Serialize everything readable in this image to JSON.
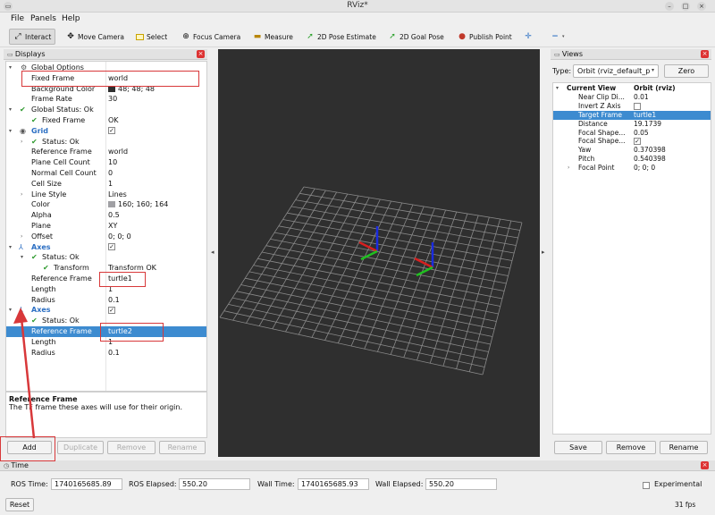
{
  "window": {
    "title": "RViz*"
  },
  "menu": [
    "File",
    "Panels",
    "Help"
  ],
  "toolbar": {
    "interact": "Interact",
    "move_camera": "Move Camera",
    "select": "Select",
    "focus_camera": "Focus Camera",
    "measure": "Measure",
    "pose_estimate": "2D Pose Estimate",
    "goal_pose": "2D Goal Pose",
    "publish_point": "Publish Point"
  },
  "displays": {
    "title": "Displays",
    "rows": [
      {
        "name": "Global Options",
        "value": ""
      },
      {
        "name": "Fixed Frame",
        "value": "world"
      },
      {
        "name": "Background Color",
        "value": "48; 48; 48"
      },
      {
        "name": "Frame Rate",
        "value": "30"
      },
      {
        "name": "Global Status: Ok",
        "value": ""
      },
      {
        "name": "Fixed Frame",
        "value": "OK"
      },
      {
        "name": "Grid",
        "value": ""
      },
      {
        "name": "Status: Ok",
        "value": ""
      },
      {
        "name": "Reference Frame",
        "value": "world"
      },
      {
        "name": "Plane Cell Count",
        "value": "10"
      },
      {
        "name": "Normal Cell Count",
        "value": "0"
      },
      {
        "name": "Cell Size",
        "value": "1"
      },
      {
        "name": "Line Style",
        "value": "Lines"
      },
      {
        "name": "Color",
        "value": "160; 160; 164"
      },
      {
        "name": "Alpha",
        "value": "0.5"
      },
      {
        "name": "Plane",
        "value": "XY"
      },
      {
        "name": "Offset",
        "value": "0; 0; 0"
      },
      {
        "name": "Axes",
        "value": ""
      },
      {
        "name": "Status: Ok",
        "value": ""
      },
      {
        "name": "Transform",
        "value": "Transform OK"
      },
      {
        "name": "Reference Frame",
        "value": "turtle1"
      },
      {
        "name": "Length",
        "value": "1"
      },
      {
        "name": "Radius",
        "value": "0.1"
      },
      {
        "name": "Axes",
        "value": ""
      },
      {
        "name": "Status: Ok",
        "value": ""
      },
      {
        "name": "Reference Frame",
        "value": "turtle2"
      },
      {
        "name": "Length",
        "value": "1"
      },
      {
        "name": "Radius",
        "value": "0.1"
      }
    ],
    "desc_title": "Reference Frame",
    "desc_text": "The TF frame these axes will use for their origin.",
    "buttons": {
      "add": "Add",
      "duplicate": "Duplicate",
      "remove": "Remove",
      "rename": "Rename"
    }
  },
  "views": {
    "title": "Views",
    "type_label": "Type:",
    "type_value": "Orbit (rviz_default_p",
    "zero": "Zero",
    "rows": [
      {
        "name": "Current View",
        "value": "Orbit (rviz)"
      },
      {
        "name": "Near Clip Di...",
        "value": "0.01"
      },
      {
        "name": "Invert Z Axis",
        "value": ""
      },
      {
        "name": "Target Frame",
        "value": "turtle1"
      },
      {
        "name": "Distance",
        "value": "19.1739"
      },
      {
        "name": "Focal Shape...",
        "value": "0.05"
      },
      {
        "name": "Focal Shape...",
        "value": ""
      },
      {
        "name": "Yaw",
        "value": "0.370398"
      },
      {
        "name": "Pitch",
        "value": "0.540398"
      },
      {
        "name": "Focal Point",
        "value": "0; 0; 0"
      }
    ],
    "buttons": {
      "save": "Save",
      "remove": "Remove",
      "rename": "Rename"
    }
  },
  "time": {
    "title": "Time",
    "ros_time_label": "ROS Time:",
    "ros_time": "1740165685.89",
    "ros_elapsed_label": "ROS Elapsed:",
    "ros_elapsed": "550.20",
    "wall_time_label": "Wall Time:",
    "wall_time": "1740165685.93",
    "wall_elapsed_label": "Wall Elapsed:",
    "wall_elapsed": "550.20",
    "experimental": "Experimental",
    "reset": "Reset",
    "fps": "31 fps"
  },
  "colors": {
    "bg_swatch": "#303030",
    "grid_swatch": "#a0a0a4",
    "selection": "#3d8bd0",
    "annotation": "#d8383a"
  }
}
